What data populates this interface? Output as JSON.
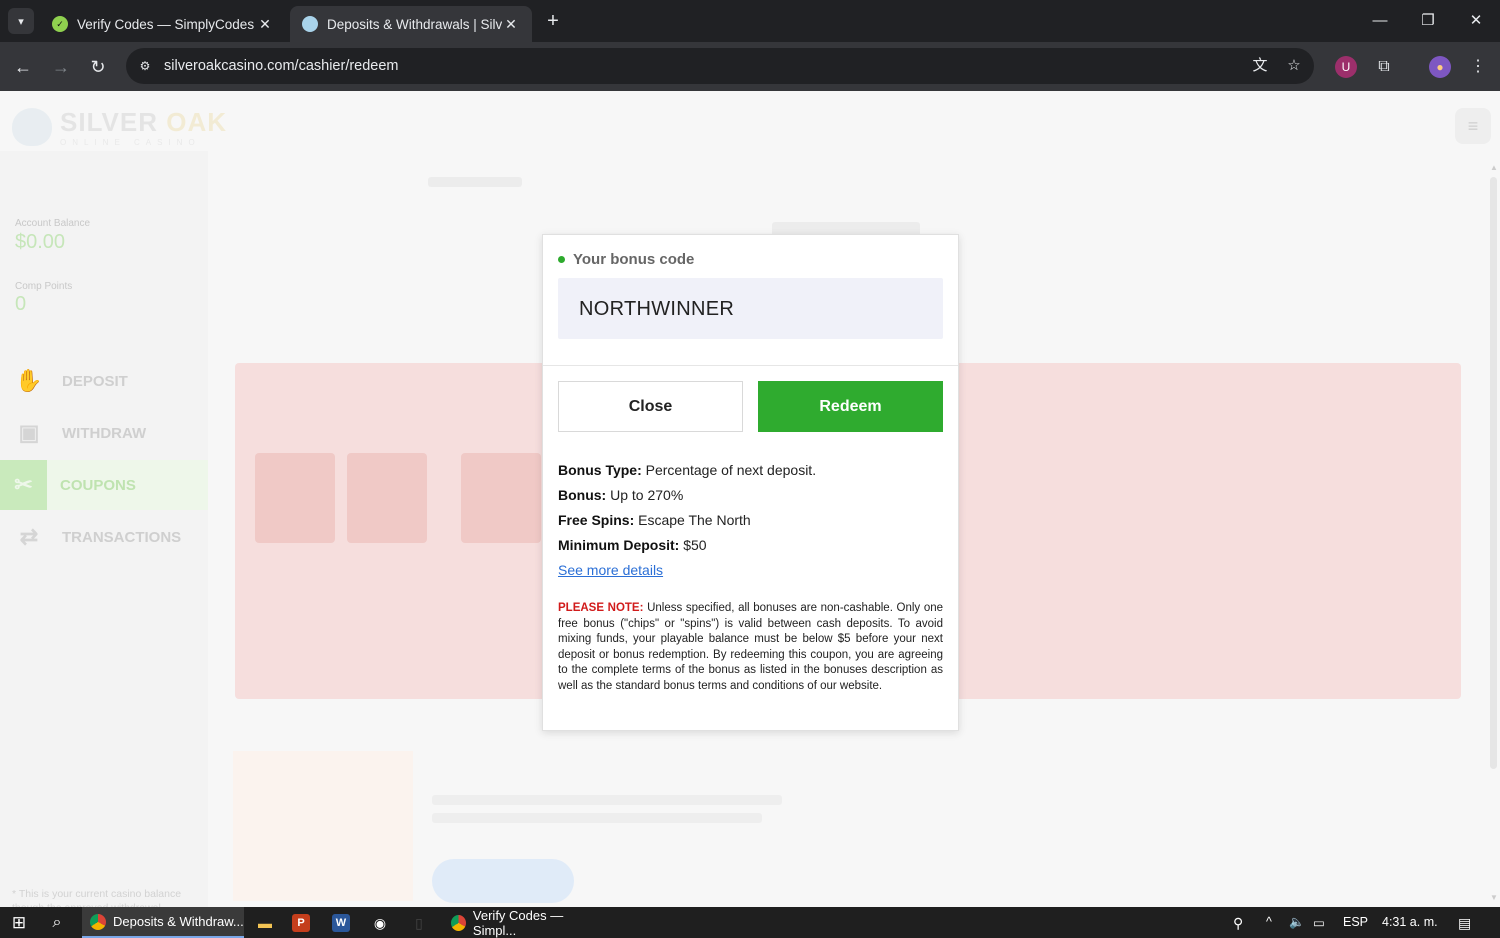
{
  "browser": {
    "tabs": [
      {
        "title": "Verify Codes — SimplyCodes",
        "favicon": "simplycodes-check-icon",
        "active": false
      },
      {
        "title": "Deposits & Withdrawals | Silver",
        "favicon": "silveroak-shield-icon",
        "active": true
      }
    ],
    "url": "silveroakcasino.com/cashier/redeem"
  },
  "site": {
    "brand": "SILVER",
    "brand_accent": "OAK",
    "brand_sub": "ONLINE CASINO",
    "account_balance_label": "Account Balance",
    "account_balance": "$0.00",
    "comp_points_label": "Comp Points",
    "comp_points": "0",
    "nav": [
      {
        "label": "DEPOSIT",
        "icon": "hand-money-icon"
      },
      {
        "label": "WITHDRAW",
        "icon": "atm-icon"
      },
      {
        "label": "COUPONS",
        "icon": "ticket-icon",
        "active": true
      },
      {
        "label": "TRANSACTIONS",
        "icon": "arrows-exchange-icon"
      }
    ],
    "balance_note": "* This is your current casino balance though the approved withdrawal amount may differ due to max cash out limits and/or removal of casino bonus cash."
  },
  "modal": {
    "heading": "Your bonus code",
    "code": "NORTHWINNER",
    "close_label": "Close",
    "redeem_label": "Redeem",
    "details": [
      {
        "label": "Bonus Type:",
        "value": "Percentage of next deposit."
      },
      {
        "label": "Bonus:",
        "value": "Up to 270%"
      },
      {
        "label": "Free Spins:",
        "value": "Escape The North"
      },
      {
        "label": "Minimum Deposit:",
        "value": "$50"
      }
    ],
    "more_link": "See more details",
    "note_label": "PLEASE NOTE:",
    "note_text": "Unless specified, all bonuses are non-cashable. Only one free bonus (\"chips\" or \"spins\") is valid between cash deposits. To avoid mixing funds, your playable balance must be below $5 before your next deposit or bonus redemption. By redeeming this coupon, you are agreeing to the complete terms of the bonus as listed in the bonuses description as well as the standard bonus terms and conditions of our website."
  },
  "taskbar": {
    "apps": [
      {
        "label": "Deposits & Withdraw...",
        "active": true
      },
      {
        "label": "Verify Codes — Simpl...",
        "active": false
      }
    ],
    "language": "ESP",
    "time": "4:31 a. m."
  },
  "colors": {
    "accent_green": "#2fab2f",
    "note_red": "#d11b1b",
    "link_blue": "#2b6fd6",
    "chrome_dark": "#202124"
  }
}
